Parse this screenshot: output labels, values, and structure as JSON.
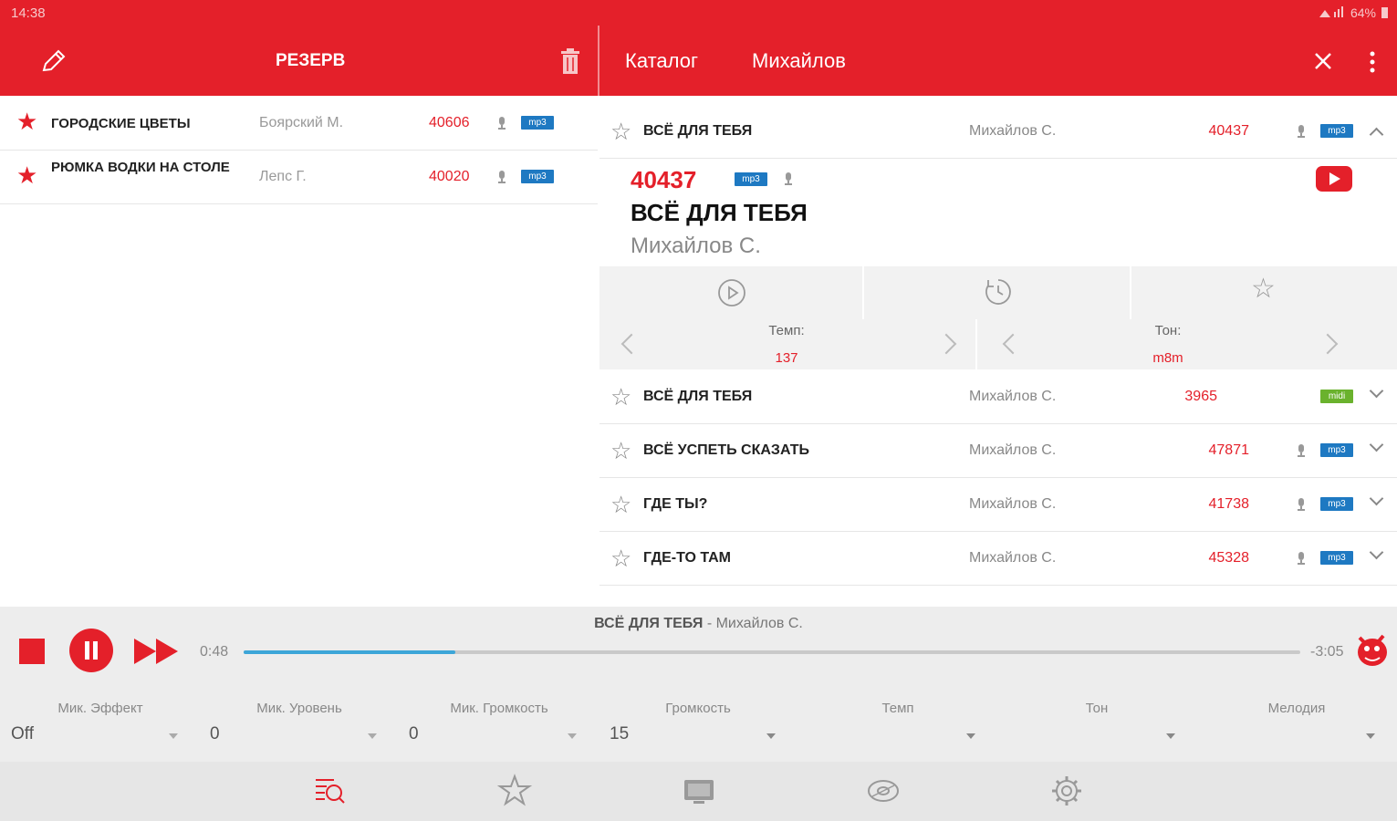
{
  "status": {
    "time": "14:38",
    "battery": "64%"
  },
  "left_panel": {
    "title": "РЕЗЕРВ",
    "rows": [
      {
        "title": "ГОРОДСКИЕ ЦВЕТЫ",
        "artist": "Боярский М.",
        "number": "40606",
        "badge": "mp3"
      },
      {
        "title": "РЮМКА ВОДКИ НА СТОЛЕ",
        "artist": "Лепс Г.",
        "number": "40020",
        "badge": "mp3"
      }
    ]
  },
  "right_panel": {
    "tabs": [
      "Каталог",
      "Михайлов"
    ],
    "expanded_row": {
      "title": "ВСЁ ДЛЯ ТЕБЯ",
      "artist": "Михайлов С.",
      "number": "40437",
      "badge": "mp3"
    },
    "detail": {
      "number": "40437",
      "badge": "mp3",
      "title": "ВСЁ ДЛЯ ТЕБЯ",
      "artist": "Михайлов С.",
      "tempo_label": "Темп:",
      "tempo_value": "137",
      "tone_label": "Тон:",
      "tone_value": "m8m"
    },
    "rows": [
      {
        "title": "ВСЁ ДЛЯ ТЕБЯ",
        "artist": "Михайлов С.",
        "number": "3965",
        "badge": "midi",
        "badge_color": "green",
        "mic": false
      },
      {
        "title": "ВСЁ УСПЕТЬ СКАЗАТЬ",
        "artist": "Михайлов С.",
        "number": "47871",
        "badge": "mp3",
        "badge_color": "blue",
        "mic": true
      },
      {
        "title": "ГДЕ ТЫ?",
        "artist": "Михайлов С.",
        "number": "41738",
        "badge": "mp3",
        "badge_color": "blue",
        "mic": true
      },
      {
        "title": "ГДЕ-ТО ТАМ",
        "artist": "Михайлов С.",
        "number": "45328",
        "badge": "mp3",
        "badge_color": "blue",
        "mic": true
      }
    ]
  },
  "player": {
    "now_title": "ВСЁ ДЛЯ ТЕБЯ",
    "now_artist": " - Михайлов С.",
    "elapsed": "0:48",
    "remaining": "-3:05",
    "progress": 0.2
  },
  "mixer": [
    {
      "label": "Мик. Эффект",
      "value": "Off"
    },
    {
      "label": "Мик. Уровень",
      "value": "0"
    },
    {
      "label": "Мик. Громкость",
      "value": "0"
    },
    {
      "label": "Громкость",
      "value": "15"
    },
    {
      "label": "Темп",
      "value": ""
    },
    {
      "label": "Тон",
      "value": ""
    },
    {
      "label": "Мелодия",
      "value": ""
    }
  ],
  "bottom_nav": [
    "catalog-icon",
    "star-icon",
    "karaoke-icon",
    "disc-icon",
    "gear-icon"
  ],
  "colors": {
    "accent": "#e4202a",
    "progress": "#3da6d8",
    "mp3_badge": "#1e79c2",
    "midi_badge": "#6ab22d"
  }
}
